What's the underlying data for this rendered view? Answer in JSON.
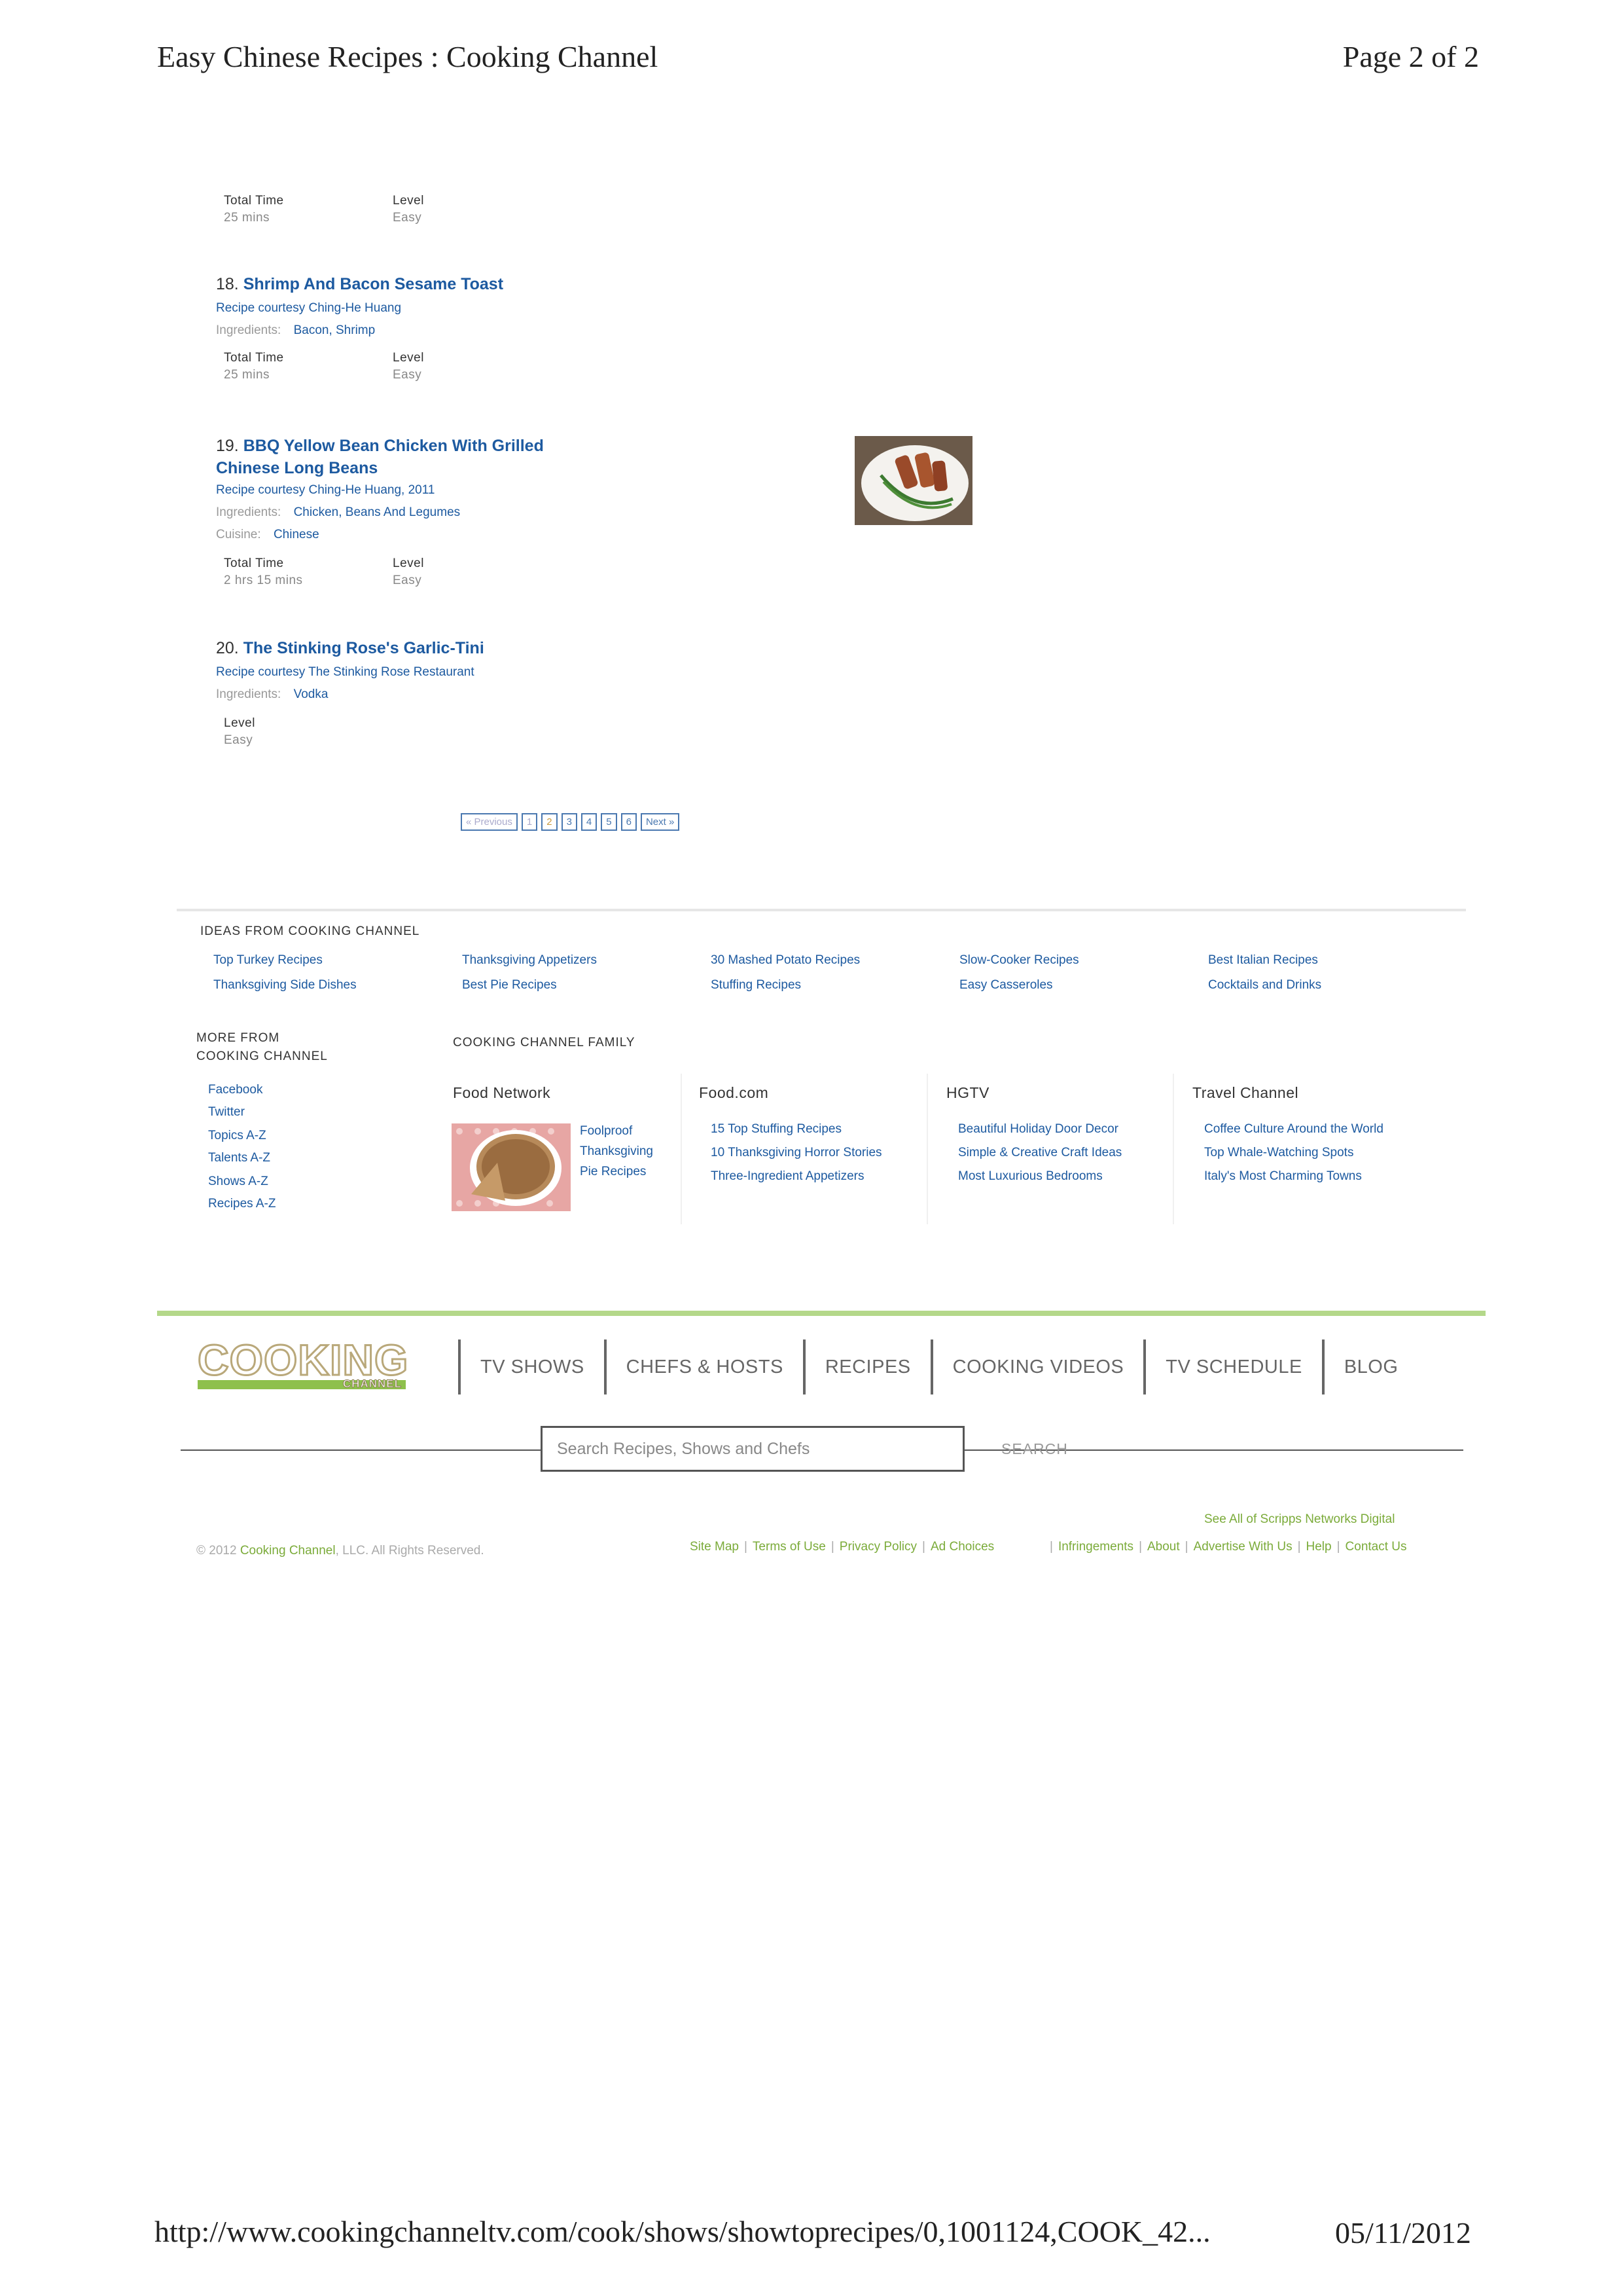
{
  "print_header": {
    "title": "Easy Chinese Recipes : Cooking Channel",
    "page": "Page 2 of 2"
  },
  "print_footer": {
    "url": "http://www.cookingchanneltv.com/cook/shows/showtoprecipes/0,1001124,COOK_42...",
    "date": "05/11/2012"
  },
  "prev_item": {
    "total_time_label": "Total Time",
    "total_time": "25 mins",
    "level_label": "Level",
    "level": "Easy"
  },
  "recipes": [
    {
      "num": "18.",
      "title": "Shrimp And Bacon Sesame Toast",
      "courtesy": "Recipe courtesy Ching-He Huang",
      "ingredients_label": "Ingredients:",
      "ingredients": "Bacon, Shrimp",
      "total_time_label": "Total Time",
      "total_time": "25 mins",
      "level_label": "Level",
      "level": "Easy"
    },
    {
      "num": "19.",
      "title_line1": "BBQ Yellow Bean Chicken With Grilled",
      "title_line2": "Chinese Long Beans",
      "courtesy": "Recipe courtesy Ching-He Huang, 2011",
      "ingredients_label": "Ingredients:",
      "ingredients": "Chicken, Beans And Legumes",
      "cuisine_label": "Cuisine:",
      "cuisine": "Chinese",
      "total_time_label": "Total Time",
      "total_time": "2 hrs 15 mins",
      "level_label": "Level",
      "level": "Easy"
    },
    {
      "num": "20.",
      "title": "The Stinking Rose's Garlic-Tini",
      "courtesy": "Recipe courtesy The Stinking Rose Restaurant",
      "ingredients_label": "Ingredients:",
      "ingredients": "Vodka",
      "level_label": "Level",
      "level": "Easy"
    }
  ],
  "pagination": {
    "prev": "« Previous",
    "pages": [
      "1",
      "2",
      "3",
      "4",
      "5",
      "6"
    ],
    "current": "2",
    "next": "Next »"
  },
  "ideas": {
    "heading": "IDEAS FROM COOKING CHANNEL",
    "columns": [
      [
        "Top Turkey Recipes",
        "Thanksgiving Side Dishes"
      ],
      [
        "Thanksgiving Appetizers",
        "Best Pie Recipes"
      ],
      [
        "30 Mashed Potato Recipes",
        "Stuffing Recipes"
      ],
      [
        "Slow-Cooker Recipes",
        "Easy Casseroles"
      ],
      [
        "Best Italian Recipes",
        "Cocktails and Drinks"
      ]
    ]
  },
  "more_from": {
    "heading_line1": "MORE FROM",
    "heading_line2": "COOKING CHANNEL",
    "links": [
      "Facebook",
      "Twitter",
      "Topics A-Z",
      "Talents A-Z",
      "Shows A-Z",
      "Recipes A-Z"
    ]
  },
  "family": {
    "heading": "COOKING CHANNEL FAMILY",
    "food_network": {
      "name": "Food Network",
      "promo": [
        "Foolproof",
        "Thanksgiving",
        "Pie Recipes"
      ]
    },
    "food_com": {
      "name": "Food.com",
      "links": [
        "15 Top Stuffing Recipes",
        "10 Thanksgiving Horror Stories",
        "Three-Ingredient Appetizers"
      ]
    },
    "hgtv": {
      "name": "HGTV",
      "links": [
        "Beautiful Holiday Door Decor",
        "Simple & Creative Craft Ideas",
        "Most Luxurious Bedrooms"
      ]
    },
    "travel": {
      "name": "Travel Channel",
      "links": [
        "Coffee Culture Around the World",
        "Top Whale-Watching Spots",
        "Italy's Most Charming Towns"
      ]
    }
  },
  "site_footer": {
    "logo_text": "COOKING",
    "logo_sub": "CHANNEL",
    "nav": [
      "TV SHOWS",
      "CHEFS & HOSTS",
      "RECIPES",
      "COOKING VIDEOS",
      "TV SCHEDULE",
      "BLOG"
    ],
    "search_placeholder": "Search Recipes, Shows and Chefs",
    "search_button": "SEARCH",
    "copyright_pre": "© 2012",
    "copyright_brand": "Cooking Channel",
    "copyright_post": ", LLC. All Rights Reserved.",
    "see_all": "See All of Scripps Networks Digital",
    "links_left": [
      "Site Map",
      "Terms of Use",
      "Privacy Policy",
      "Ad Choices"
    ],
    "links_right": [
      "Infringements",
      "About",
      "Advertise With Us",
      "Help",
      "Contact Us"
    ]
  },
  "colors": {
    "link": "#1d5aa0",
    "brand_green": "#7bab3a",
    "bar_green": "#b4d88a"
  }
}
